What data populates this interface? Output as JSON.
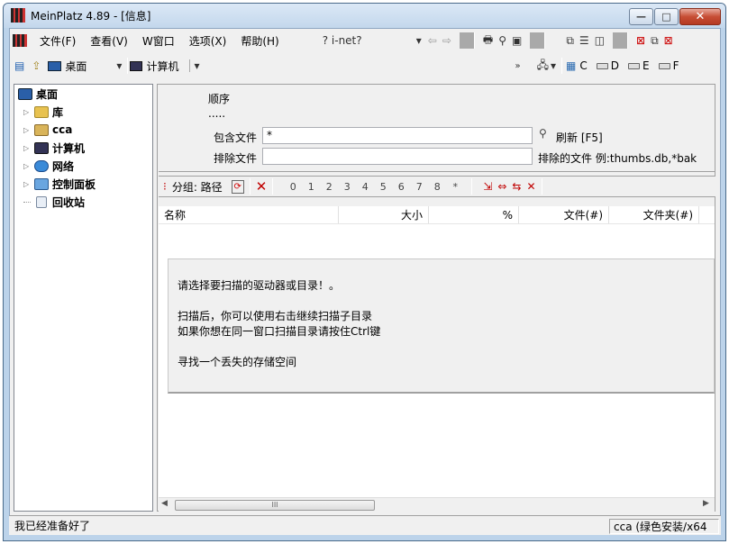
{
  "window": {
    "title": "MeinPlatz 4.89 - [信息]",
    "buttons": {
      "minimize": "—",
      "maximize": "□",
      "close": "✕"
    }
  },
  "menu": {
    "items": [
      "文件(F)",
      "查看(V)",
      "W窗口",
      "选项(X)",
      "帮助(H)"
    ],
    "help_query": "? i-net?"
  },
  "toolbar2": {
    "desktop_combo": "桌面",
    "computer_combo": "计算机",
    "drives": [
      "C",
      "D",
      "E",
      "F"
    ]
  },
  "tree": {
    "items": [
      {
        "label": "桌面",
        "indent": 0,
        "expand": ""
      },
      {
        "label": "库",
        "indent": 1,
        "expand": "▷"
      },
      {
        "label": "cca",
        "indent": 1,
        "expand": "▷"
      },
      {
        "label": "计算机",
        "indent": 1,
        "expand": "▷"
      },
      {
        "label": "网络",
        "indent": 1,
        "expand": "▷"
      },
      {
        "label": "控制面板",
        "indent": 1,
        "expand": "▷"
      },
      {
        "label": "回收站",
        "indent": 1,
        "expand": ""
      }
    ]
  },
  "filter": {
    "order_label": "顺序",
    "order_value": ".....",
    "include_label": "包含文件",
    "include_value": "*",
    "exclude_label": "排除文件",
    "exclude_value": "",
    "refresh_label": "刷新 [F5]",
    "exclude_hint": "排除的文件 例:thumbs.db,*bak"
  },
  "tool3": {
    "group_label": "分组: 路径",
    "levels": [
      "0",
      "1",
      "2",
      "3",
      "4",
      "5",
      "6",
      "7",
      "8",
      "*"
    ]
  },
  "columns": [
    "名称",
    "大小",
    "%",
    "文件(#)",
    "文件夹(#)"
  ],
  "message": {
    "line1": "请选择要扫描的驱动器或目录！。",
    "line2": "扫描后，你可以使用右击继续扫描子目录",
    "line3": "如果你想在同一窗口扫描目录请按住Ctrl键",
    "line4": "寻找一个丢失的存储空间"
  },
  "scrollbar": {
    "thumb": "III"
  },
  "status": {
    "left": "我已经准备好了",
    "right": "cca (绿色安装/x64"
  },
  "colors": {
    "accent_red": "#c00000",
    "title_bg": "#c3d7ec"
  }
}
